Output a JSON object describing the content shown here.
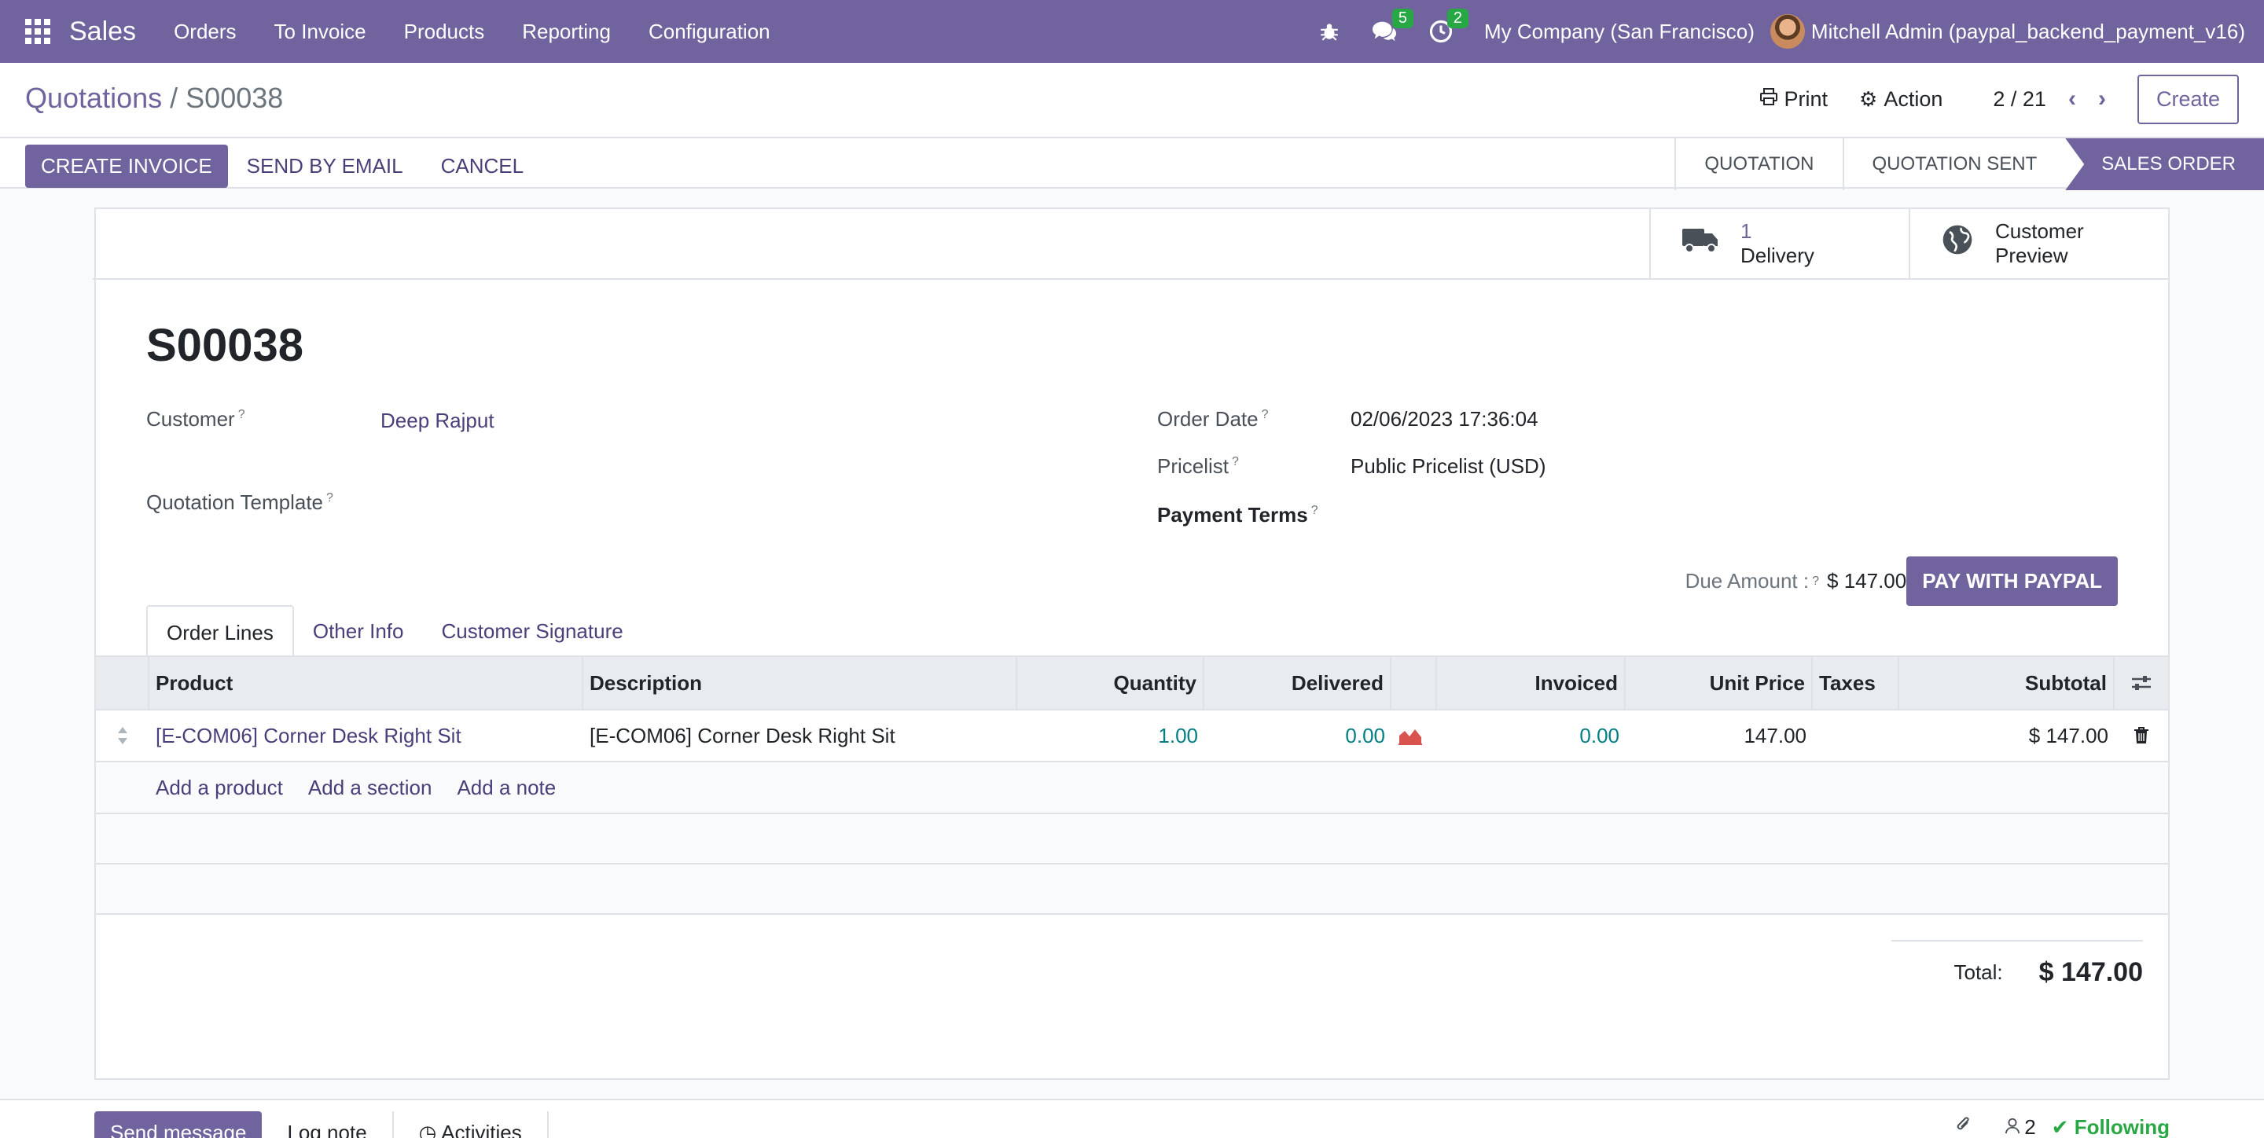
{
  "navbar": {
    "app_name": "Sales",
    "menu": [
      "Orders",
      "To Invoice",
      "Products",
      "Reporting",
      "Configuration"
    ],
    "messages_count": "5",
    "activities_count": "2",
    "company": "My Company (San Francisco)",
    "user": "Mitchell Admin (paypal_backend_payment_v16)"
  },
  "control": {
    "breadcrumb_parent": "Quotations",
    "breadcrumb_sep": "/",
    "breadcrumb_current": "S00038",
    "print_label": "Print",
    "action_label": "Action",
    "pager": "2 / 21",
    "create_label": "Create"
  },
  "statusbar": {
    "create_invoice": "Create Invoice",
    "send_email": "Send by Email",
    "cancel": "Cancel",
    "stages": [
      "Quotation",
      "Quotation Sent",
      "Sales Order"
    ],
    "active_stage": "Sales Order"
  },
  "smart_buttons": {
    "delivery_count": "1",
    "delivery_label": "Delivery",
    "preview_line1": "Customer",
    "preview_line2": "Preview"
  },
  "form": {
    "name": "S00038",
    "customer_label": "Customer",
    "customer_value": "Deep Rajput",
    "template_label": "Quotation Template",
    "order_date_label": "Order Date",
    "order_date_value": "02/06/2023 17:36:04",
    "pricelist_label": "Pricelist",
    "pricelist_value": "Public Pricelist (USD)",
    "payment_terms_label": "Payment Terms",
    "help_mark": "?",
    "due_label": "Due Amount :",
    "due_value": "$ 147.00",
    "paypal_button": "Pay with Paypal"
  },
  "tabs": [
    "Order Lines",
    "Other Info",
    "Customer Signature"
  ],
  "order_lines": {
    "headers": {
      "product": "Product",
      "description": "Description",
      "quantity": "Quantity",
      "delivered": "Delivered",
      "invoiced": "Invoiced",
      "unit_price": "Unit Price",
      "taxes": "Taxes",
      "subtotal": "Subtotal"
    },
    "rows": [
      {
        "product": "[E-COM06] Corner Desk Right Sit",
        "description": "[E-COM06] Corner Desk Right Sit",
        "quantity": "1.00",
        "delivered": "0.00",
        "invoiced": "0.00",
        "unit_price": "147.00",
        "taxes": "",
        "subtotal": "$ 147.00"
      }
    ],
    "add_product": "Add a product",
    "add_section": "Add a section",
    "add_note": "Add a note"
  },
  "totals": {
    "label": "Total:",
    "value": "$ 147.00"
  },
  "chatter": {
    "send_message": "Send message",
    "log_note": "Log note",
    "activities": "Activities",
    "followers_count": "2",
    "following": "Following"
  },
  "colors": {
    "brand": "#71639e",
    "link": "#4b3f7a",
    "numeric_link": "#017e84",
    "badge": "#28a745"
  }
}
